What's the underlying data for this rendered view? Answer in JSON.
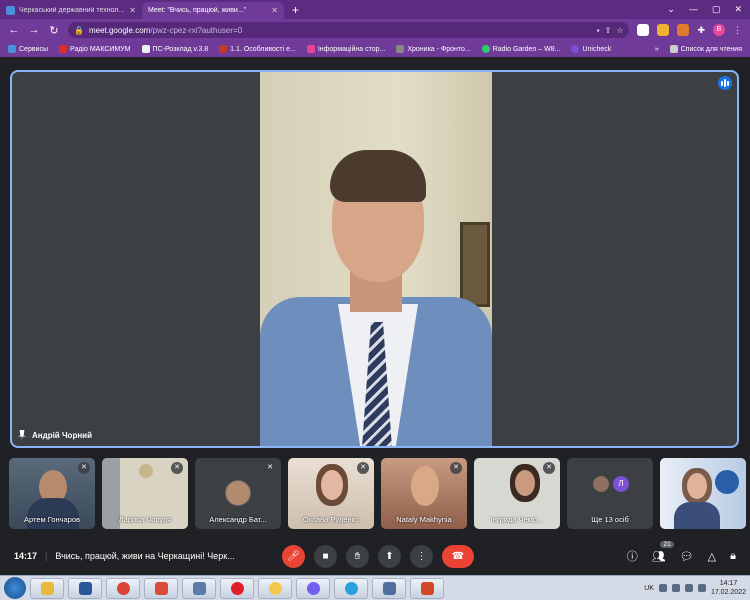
{
  "browser": {
    "tabs": [
      {
        "title": "Черкаський державний технол..."
      },
      {
        "title": "Meet: \"Вчись, працюй, живи...\""
      }
    ],
    "url_base": "meet.google.com",
    "url_path": "/pwz-cpez-rxi?authuser=0",
    "profile_initial": "В",
    "bookmarks": [
      "Сервисы",
      "Радіо МАКСИМУМ",
      "ПС-Розклад v.3.8",
      "1.1. Особливості е...",
      "Інформаційна стор...",
      "Хроника - Фронто...",
      "Radio Garden – W8...",
      "Unicheck"
    ],
    "reading_list": "Список для чтения"
  },
  "meet": {
    "main_speaker": "Андрій Чорний",
    "participants": [
      {
        "name": "Артем Гончаров"
      },
      {
        "name": "Лариса Чопуря"
      },
      {
        "name": "Александр Бат..."
      },
      {
        "name": "Оксана Руденко"
      },
      {
        "name": "Nataly Makhynia"
      },
      {
        "name": "Інгрида Чемо..."
      },
      {
        "name": "Ще 13 осіб"
      },
      {
        "name": ""
      }
    ],
    "more_avatar_letter": "Л",
    "time": "14:17",
    "meeting_title": "Вчись, працюй, живи на Черкащині! Черк...",
    "people_count": "21"
  },
  "taskbar": {
    "language": "UK",
    "time": "14:17",
    "date": "17.02.2022"
  }
}
